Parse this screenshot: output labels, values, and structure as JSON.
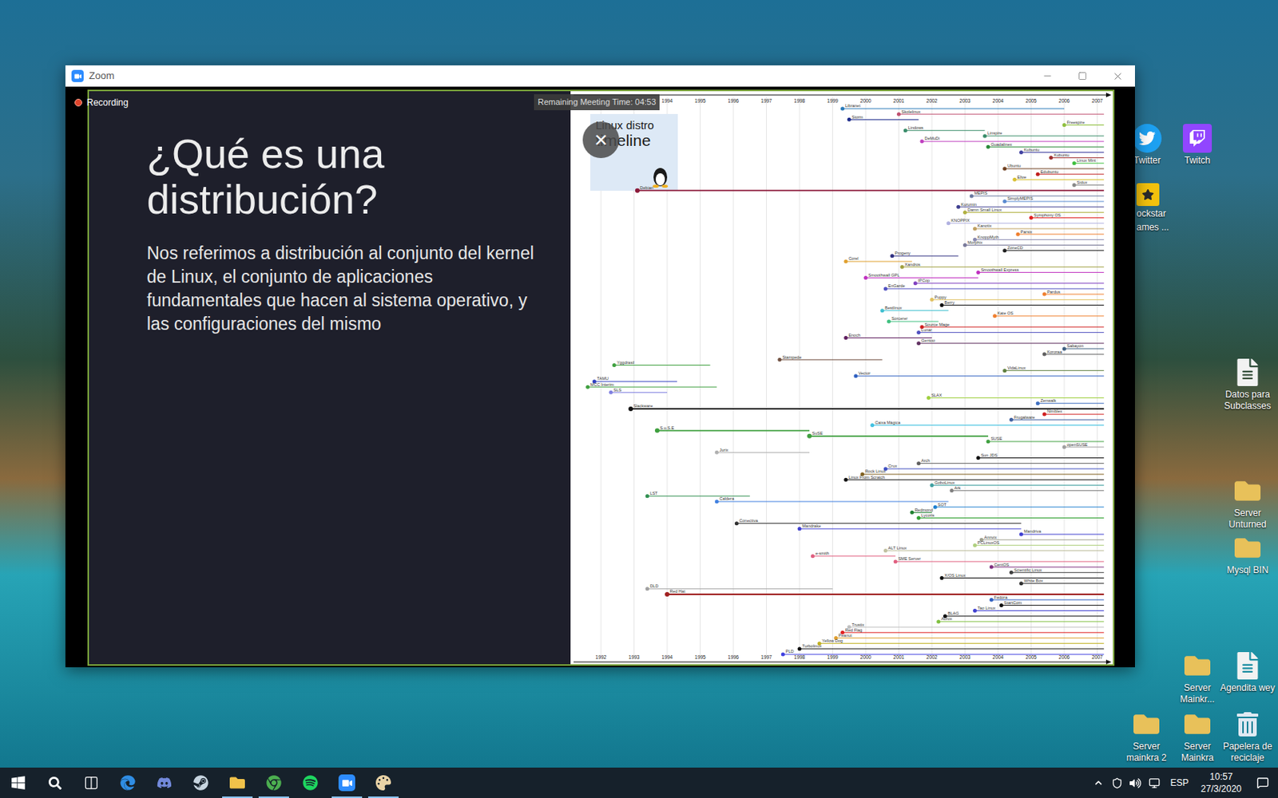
{
  "window": {
    "title": "Zoom"
  },
  "meeting": {
    "recording": "Recording",
    "timer": "Remaining Meeting Time: 04:53",
    "close": "×"
  },
  "slide": {
    "title": "¿Qué es una distribución?",
    "body": "Nos referimos a distribución al conjunto del kernel de Linux, el conjunto de aplicaciones fundamentales que hacen al sistema operativo, y las configuraciones del mismo"
  },
  "chart": {
    "title": [
      "Linux distro",
      "timeline"
    ],
    "years": [
      "1992",
      "1993",
      "1994",
      "1995",
      "1996",
      "1997",
      "1998",
      "1999",
      "2000",
      "2001",
      "2002",
      "2003",
      "2004",
      "2005",
      "2006",
      "2007"
    ],
    "distros": [
      {
        "name": "Libranet",
        "start": 1999.3,
        "end": 2006.0,
        "color": "#2a7ab8",
        "kind": "branch"
      },
      {
        "name": "Skolelinux",
        "start": 2001.0,
        "end": 2007.2,
        "color": "#c05070",
        "kind": "branch"
      },
      {
        "name": "Storm",
        "start": 1999.5,
        "end": 2001.6,
        "color": "#1d2b8a",
        "kind": "branch"
      },
      {
        "name": "Freespire",
        "start": 2006.0,
        "end": 2007.2,
        "color": "#8fbf3f",
        "kind": "branch"
      },
      {
        "name": "Lindows",
        "start": 2001.2,
        "end": 2003.6,
        "color": "#3a8c6a",
        "kind": "branch"
      },
      {
        "name": "Linspire",
        "start": 2003.6,
        "end": 2007.2,
        "color": "#3a8c6a",
        "kind": "branch"
      },
      {
        "name": "DeMuDi",
        "start": 2001.7,
        "end": 2007.2,
        "color": "#c040c0",
        "kind": "branch"
      },
      {
        "name": "Guadalinex",
        "start": 2003.7,
        "end": 2007.2,
        "color": "#2a8a3a",
        "kind": "branch"
      },
      {
        "name": "Kubuntu",
        "start": 2004.7,
        "end": 2007.2,
        "color": "#4040a0",
        "kind": "branch"
      },
      {
        "name": "Xubuntu",
        "start": 2005.6,
        "end": 2007.2,
        "color": "#a03030",
        "kind": "branch"
      },
      {
        "name": "Linux Mint",
        "start": 2006.3,
        "end": 2007.2,
        "color": "#40c040",
        "kind": "branch"
      },
      {
        "name": "Ubuntu",
        "start": 2004.2,
        "end": 2007.2,
        "color": "#704020",
        "kind": "branch"
      },
      {
        "name": "Edubuntu",
        "start": 2005.2,
        "end": 2007.2,
        "color": "#c02020",
        "kind": "branch"
      },
      {
        "name": "Elive",
        "start": 2004.5,
        "end": 2007.2,
        "color": "#d8c030",
        "kind": "branch"
      },
      {
        "name": "Sidux",
        "start": 2006.3,
        "end": 2007.2,
        "color": "#888888",
        "kind": "branch"
      },
      {
        "name": "Debian",
        "start": 1993.1,
        "end": 2007.2,
        "color": "#8b1a3a",
        "kind": "trunk"
      },
      {
        "name": "MEPIS",
        "start": 2003.2,
        "end": 2007.2,
        "color": "#6a7aa0",
        "kind": "branch"
      },
      {
        "name": "SimplyMEPIS",
        "start": 2004.2,
        "end": 2007.2,
        "color": "#5a8ad0",
        "kind": "branch"
      },
      {
        "name": "Kurumin",
        "start": 2002.8,
        "end": 2007.2,
        "color": "#404090",
        "kind": "branch"
      },
      {
        "name": "Damn Small Linux",
        "start": 2003.0,
        "end": 2007.2,
        "color": "#b0b040",
        "kind": "branch"
      },
      {
        "name": "Symphony OS",
        "start": 2005.0,
        "end": 2007.2,
        "color": "#e02020",
        "kind": "branch"
      },
      {
        "name": "KNOPPIX",
        "start": 2002.5,
        "end": 2007.2,
        "color": "#b0b0e0",
        "kind": "branch"
      },
      {
        "name": "Kanotix",
        "start": 2003.3,
        "end": 2007.2,
        "color": "#c0a060",
        "kind": "branch"
      },
      {
        "name": "Parsix",
        "start": 2004.6,
        "end": 2007.2,
        "color": "#f08030",
        "kind": "branch"
      },
      {
        "name": "KnoppMyth",
        "start": 2003.3,
        "end": 2007.2,
        "color": "#8a8ab0",
        "kind": "branch"
      },
      {
        "name": "Morphix",
        "start": 2003.0,
        "end": 2007.2,
        "color": "#7a7a9a",
        "kind": "branch"
      },
      {
        "name": "ZoneCD",
        "start": 2004.2,
        "end": 2007.2,
        "color": "#202020",
        "kind": "branch"
      },
      {
        "name": "Progeny",
        "start": 2000.8,
        "end": 2002.8,
        "color": "#303080",
        "kind": "branch"
      },
      {
        "name": "Corel",
        "start": 1999.4,
        "end": 2001.4,
        "color": "#e0a030",
        "kind": "branch"
      },
      {
        "name": "Xandros",
        "start": 2001.1,
        "end": 2007.2,
        "color": "#a0a040",
        "kind": "branch"
      },
      {
        "name": "Smoothwall Express",
        "start": 2003.4,
        "end": 2007.2,
        "color": "#c030c0",
        "kind": "branch"
      },
      {
        "name": "Smoothwall GPL",
        "start": 2000.0,
        "end": 2003.4,
        "color": "#c030c0",
        "kind": "branch"
      },
      {
        "name": "IPCop",
        "start": 2001.5,
        "end": 2007.2,
        "color": "#8040c0",
        "kind": "branch"
      },
      {
        "name": "EnGarde",
        "start": 2000.6,
        "end": 2007.2,
        "color": "#5050c0",
        "kind": "branch"
      },
      {
        "name": "Pardus",
        "start": 2005.4,
        "end": 2007.2,
        "color": "#f08030",
        "kind": "branch"
      },
      {
        "name": "Puppy",
        "start": 2002.0,
        "end": 2007.2,
        "color": "#e0c060",
        "kind": "branch"
      },
      {
        "name": "Berry",
        "start": 2002.3,
        "end": 2007.2,
        "color": "#111111",
        "kind": "branch"
      },
      {
        "name": "Bestlinux",
        "start": 2000.5,
        "end": 2002.5,
        "color": "#40c0d0",
        "kind": "branch"
      },
      {
        "name": "Kate OS",
        "start": 2003.9,
        "end": 2007.2,
        "color": "#f08030",
        "kind": "branch"
      },
      {
        "name": "Sorcerer",
        "start": 2000.7,
        "end": 2002.2,
        "color": "#40c080",
        "kind": "branch"
      },
      {
        "name": "Source Mage",
        "start": 2001.7,
        "end": 2007.2,
        "color": "#d02020",
        "kind": "branch"
      },
      {
        "name": "Lunar",
        "start": 2001.6,
        "end": 2007.2,
        "color": "#5050c0",
        "kind": "branch"
      },
      {
        "name": "Enoch",
        "start": 1999.4,
        "end": 2002.0,
        "color": "#602060",
        "kind": "branch"
      },
      {
        "name": "Gentoo",
        "start": 2001.6,
        "end": 2007.2,
        "color": "#603060",
        "kind": "branch"
      },
      {
        "name": "Sabayon",
        "start": 2006.0,
        "end": 2007.2,
        "color": "#406080",
        "kind": "branch"
      },
      {
        "name": "Kororaa",
        "start": 2005.4,
        "end": 2007.2,
        "color": "#606060",
        "kind": "branch"
      },
      {
        "name": "Stampede",
        "start": 1997.4,
        "end": 2000.5,
        "color": "#705040",
        "kind": "branch"
      },
      {
        "name": "Yggdrasil",
        "start": 1992.4,
        "end": 1995.3,
        "color": "#40a040",
        "kind": "branch"
      },
      {
        "name": "VidaLinux",
        "start": 2004.2,
        "end": 2007.2,
        "color": "#608040",
        "kind": "branch"
      },
      {
        "name": "Vector",
        "start": 1999.7,
        "end": 2007.2,
        "color": "#3060c0",
        "kind": "branch"
      },
      {
        "name": "TAMU",
        "start": 1991.8,
        "end": 1994.3,
        "color": "#3040c0",
        "kind": "branch"
      },
      {
        "name": "MCC Interim",
        "start": 1991.6,
        "end": 1995.5,
        "color": "#40a040",
        "kind": "branch"
      },
      {
        "name": "SLS",
        "start": 1992.3,
        "end": 1994.0,
        "color": "#8080e0",
        "kind": "branch"
      },
      {
        "name": "SLAX",
        "start": 2001.9,
        "end": 2007.2,
        "color": "#a0d040",
        "kind": "branch"
      },
      {
        "name": "Zenwalk",
        "start": 2005.2,
        "end": 2007.2,
        "color": "#4070c0",
        "kind": "branch"
      },
      {
        "name": "Slackware",
        "start": 1992.9,
        "end": 2007.2,
        "color": "#111111",
        "kind": "trunk"
      },
      {
        "name": "Nimblex",
        "start": 2005.4,
        "end": 2007.2,
        "color": "#d02020",
        "kind": "branch"
      },
      {
        "name": "Frugalware",
        "start": 2004.4,
        "end": 2007.2,
        "color": "#4060a0",
        "kind": "branch"
      },
      {
        "name": "Caixa Mágica",
        "start": 2000.2,
        "end": 2007.2,
        "color": "#40c0e0",
        "kind": "branch"
      },
      {
        "name": "S.u.S.E",
        "start": 1993.7,
        "end": 1998.3,
        "color": "#40a040",
        "kind": "trunk"
      },
      {
        "name": "SuSE",
        "start": 1998.3,
        "end": 2003.7,
        "color": "#40a040",
        "kind": "trunk"
      },
      {
        "name": "SUSE",
        "start": 2003.7,
        "end": 2007.2,
        "color": "#40a040",
        "kind": "branch"
      },
      {
        "name": "openSUSE",
        "start": 2006.0,
        "end": 2007.2,
        "color": "#a0a0a0",
        "kind": "branch"
      },
      {
        "name": "Jurix",
        "start": 1995.5,
        "end": 1998.3,
        "color": "#b0b0b0",
        "kind": "branch"
      },
      {
        "name": "Sun JDS",
        "start": 2003.4,
        "end": 2007.2,
        "color": "#111111",
        "kind": "branch"
      },
      {
        "name": "Arch",
        "start": 2001.6,
        "end": 2007.2,
        "color": "#606060",
        "kind": "branch"
      },
      {
        "name": "Crux",
        "start": 2000.6,
        "end": 2007.2,
        "color": "#4050c0",
        "kind": "branch"
      },
      {
        "name": "Rock Linux",
        "start": 1999.9,
        "end": 2007.2,
        "color": "#806020",
        "kind": "branch"
      },
      {
        "name": "Linux From Scratch",
        "start": 1999.4,
        "end": 2007.2,
        "color": "#111111",
        "kind": "branch"
      },
      {
        "name": "GoboLinux",
        "start": 2002.0,
        "end": 2007.2,
        "color": "#40a0a0",
        "kind": "branch"
      },
      {
        "name": "Ark",
        "start": 2002.6,
        "end": 2007.2,
        "color": "#808080",
        "kind": "branch"
      },
      {
        "name": "LST",
        "start": 1993.4,
        "end": 1996.5,
        "color": "#309050",
        "kind": "branch"
      },
      {
        "name": "Caldera",
        "start": 1995.5,
        "end": 2002.5,
        "color": "#4080e0",
        "kind": "branch"
      },
      {
        "name": "SOT",
        "start": 2002.1,
        "end": 2007.2,
        "color": "#2080d0",
        "kind": "branch"
      },
      {
        "name": "Redmond",
        "start": 2001.4,
        "end": 2002.0,
        "color": "#208030",
        "kind": "branch"
      },
      {
        "name": "Lycoris",
        "start": 2001.6,
        "end": 2007.2,
        "color": "#30a030",
        "kind": "branch"
      },
      {
        "name": "Conectiva",
        "start": 1996.1,
        "end": 2004.7,
        "color": "#303030",
        "kind": "branch"
      },
      {
        "name": "Mandrake",
        "start": 1998.0,
        "end": 2004.7,
        "color": "#4040d0",
        "kind": "branch"
      },
      {
        "name": "Mandriva",
        "start": 2004.7,
        "end": 2007.2,
        "color": "#4040d0",
        "kind": "branch"
      },
      {
        "name": "Annvix",
        "start": 2003.5,
        "end": 2007.2,
        "color": "#a0a090",
        "kind": "branch"
      },
      {
        "name": "PCLinuxOS",
        "start": 2003.3,
        "end": 2007.2,
        "color": "#b0d080",
        "kind": "branch"
      },
      {
        "name": "ALT Linux",
        "start": 2000.6,
        "end": 2007.2,
        "color": "#c0c0a0",
        "kind": "branch"
      },
      {
        "name": "e-smith",
        "start": 1998.4,
        "end": 2000.9,
        "color": "#e06080",
        "kind": "branch"
      },
      {
        "name": "SME Server",
        "start": 2000.9,
        "end": 2007.2,
        "color": "#e06080",
        "kind": "branch"
      },
      {
        "name": "CentOS",
        "start": 2003.8,
        "end": 2007.2,
        "color": "#803080",
        "kind": "branch"
      },
      {
        "name": "Scientific Linux",
        "start": 2004.4,
        "end": 2007.2,
        "color": "#404040",
        "kind": "branch"
      },
      {
        "name": "X/OS Linux",
        "start": 2002.3,
        "end": 2007.2,
        "color": "#111111",
        "kind": "branch"
      },
      {
        "name": "White Box",
        "start": 2004.7,
        "end": 2007.2,
        "color": "#303030",
        "kind": "branch"
      },
      {
        "name": "DLD",
        "start": 1993.4,
        "end": 1999.0,
        "color": "#a0a0a0",
        "kind": "branch"
      },
      {
        "name": "Red Hat",
        "start": 1994.0,
        "end": 2007.2,
        "color": "#a02020",
        "kind": "trunk"
      },
      {
        "name": "Fedora",
        "start": 2003.8,
        "end": 2007.2,
        "color": "#3060c0",
        "kind": "branch"
      },
      {
        "name": "StartCom",
        "start": 2004.1,
        "end": 2007.2,
        "color": "#111111",
        "kind": "branch"
      },
      {
        "name": "Tao Linux",
        "start": 2003.3,
        "end": 2007.2,
        "color": "#4040d0",
        "kind": "branch"
      },
      {
        "name": "BLAG",
        "start": 2002.4,
        "end": 2007.2,
        "color": "#111111",
        "kind": "branch"
      },
      {
        "name": "Aurox",
        "start": 2002.2,
        "end": 2007.2,
        "color": "#80c040",
        "kind": "branch"
      },
      {
        "name": "Trustix",
        "start": 1999.5,
        "end": 2007.2,
        "color": "#c0c0c0",
        "kind": "branch"
      },
      {
        "name": "Red Flag",
        "start": 1999.3,
        "end": 2007.2,
        "color": "#e02020",
        "kind": "branch"
      },
      {
        "name": "Peanut",
        "start": 1999.1,
        "end": 2007.2,
        "color": "#e0a030",
        "kind": "branch"
      },
      {
        "name": "Yellow Dog",
        "start": 1998.6,
        "end": 2007.2,
        "color": "#c0b020",
        "kind": "branch"
      },
      {
        "name": "Turbolinux",
        "start": 1998.0,
        "end": 2007.2,
        "color": "#111111",
        "kind": "branch"
      },
      {
        "name": "PLD",
        "start": 1997.5,
        "end": 2007.2,
        "color": "#4040e0",
        "kind": "branch"
      }
    ]
  },
  "desktop_icons": [
    {
      "label": [
        "Twitter"
      ],
      "kind": "twitter"
    },
    {
      "label": [
        "Twitch"
      ],
      "kind": "twitch"
    },
    {
      "label": [
        "ockstar",
        "ames ..."
      ],
      "kind": "rockstar"
    },
    {
      "label": [
        "Datos para Subclasses"
      ],
      "kind": "doc"
    },
    {
      "label": [
        "Server Unturned"
      ],
      "kind": "folder"
    },
    {
      "label": [
        "Mysql BIN"
      ],
      "kind": "folder"
    },
    {
      "label": [
        "Server Mainkr..."
      ],
      "kind": "folder"
    },
    {
      "label": [
        "Agendita wey"
      ],
      "kind": "doc"
    },
    {
      "label": [
        "Server mainkra 2"
      ],
      "kind": "folder"
    },
    {
      "label": [
        "Server Mainkra"
      ],
      "kind": "folder"
    },
    {
      "label": [
        "Papelera de reciclaje"
      ],
      "kind": "recycle"
    }
  ],
  "taskbar": {
    "apps": [
      {
        "kind": "start",
        "open": false
      },
      {
        "kind": "search",
        "open": false
      },
      {
        "kind": "taskview",
        "open": false
      },
      {
        "kind": "edge",
        "open": false
      },
      {
        "kind": "discord",
        "open": false
      },
      {
        "kind": "steam",
        "open": false
      },
      {
        "kind": "explorer",
        "open": true
      },
      {
        "kind": "chrome",
        "open": true
      },
      {
        "kind": "spotify",
        "open": false
      },
      {
        "kind": "zoom",
        "open": true
      },
      {
        "kind": "paint",
        "open": true
      }
    ],
    "language": "ESP",
    "time": "10:57",
    "date": "27/3/2020"
  }
}
